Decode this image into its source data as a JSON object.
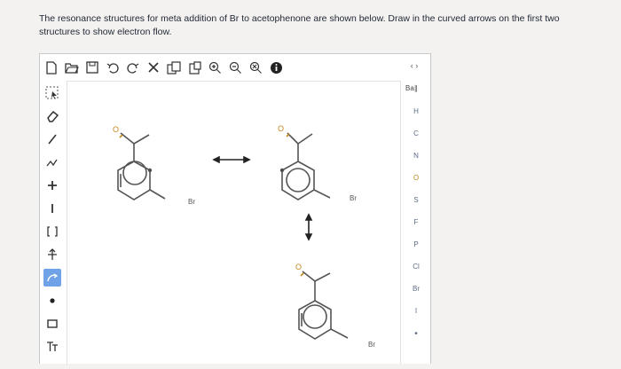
{
  "question": {
    "line1": "The resonance structures for meta addition of Br to acetophenone are shown below. Draw in the curved arrows on the first two",
    "line2": "structures to show electron flow."
  },
  "toolbar": {
    "tools": [
      "new-file-icon",
      "open-folder-icon",
      "save-icon",
      "undo-icon",
      "redo-icon",
      "delete-x-icon",
      "copy-icon",
      "paste-icon",
      "zoom-in-icon",
      "zoom-out-icon",
      "zoom-reset-icon",
      "info-icon"
    ],
    "expand": "‹ ›"
  },
  "sidebar": {
    "tools": [
      "select-icon",
      "eraser-icon",
      "single-bond-icon",
      "bond-chain-icon",
      "charge-plus-icon",
      "charge-minus-icon",
      "bracket-icon",
      "arrow-tool-icon",
      "curved-arrow-icon",
      "lone-pair-icon",
      "rectangle-icon",
      "text-icon"
    ]
  },
  "elements": {
    "periodic": "Ba∥",
    "list": [
      "H",
      "C",
      "N",
      "O",
      "S",
      "F",
      "P",
      "Cl",
      "Br",
      "I",
      "•"
    ]
  },
  "molecules": {
    "o_label": "O",
    "br_label": "Br"
  },
  "colors": {
    "oxygen": "#c4871c",
    "active_tool": "#6fa2e6",
    "element_text": "#5c6c84"
  }
}
